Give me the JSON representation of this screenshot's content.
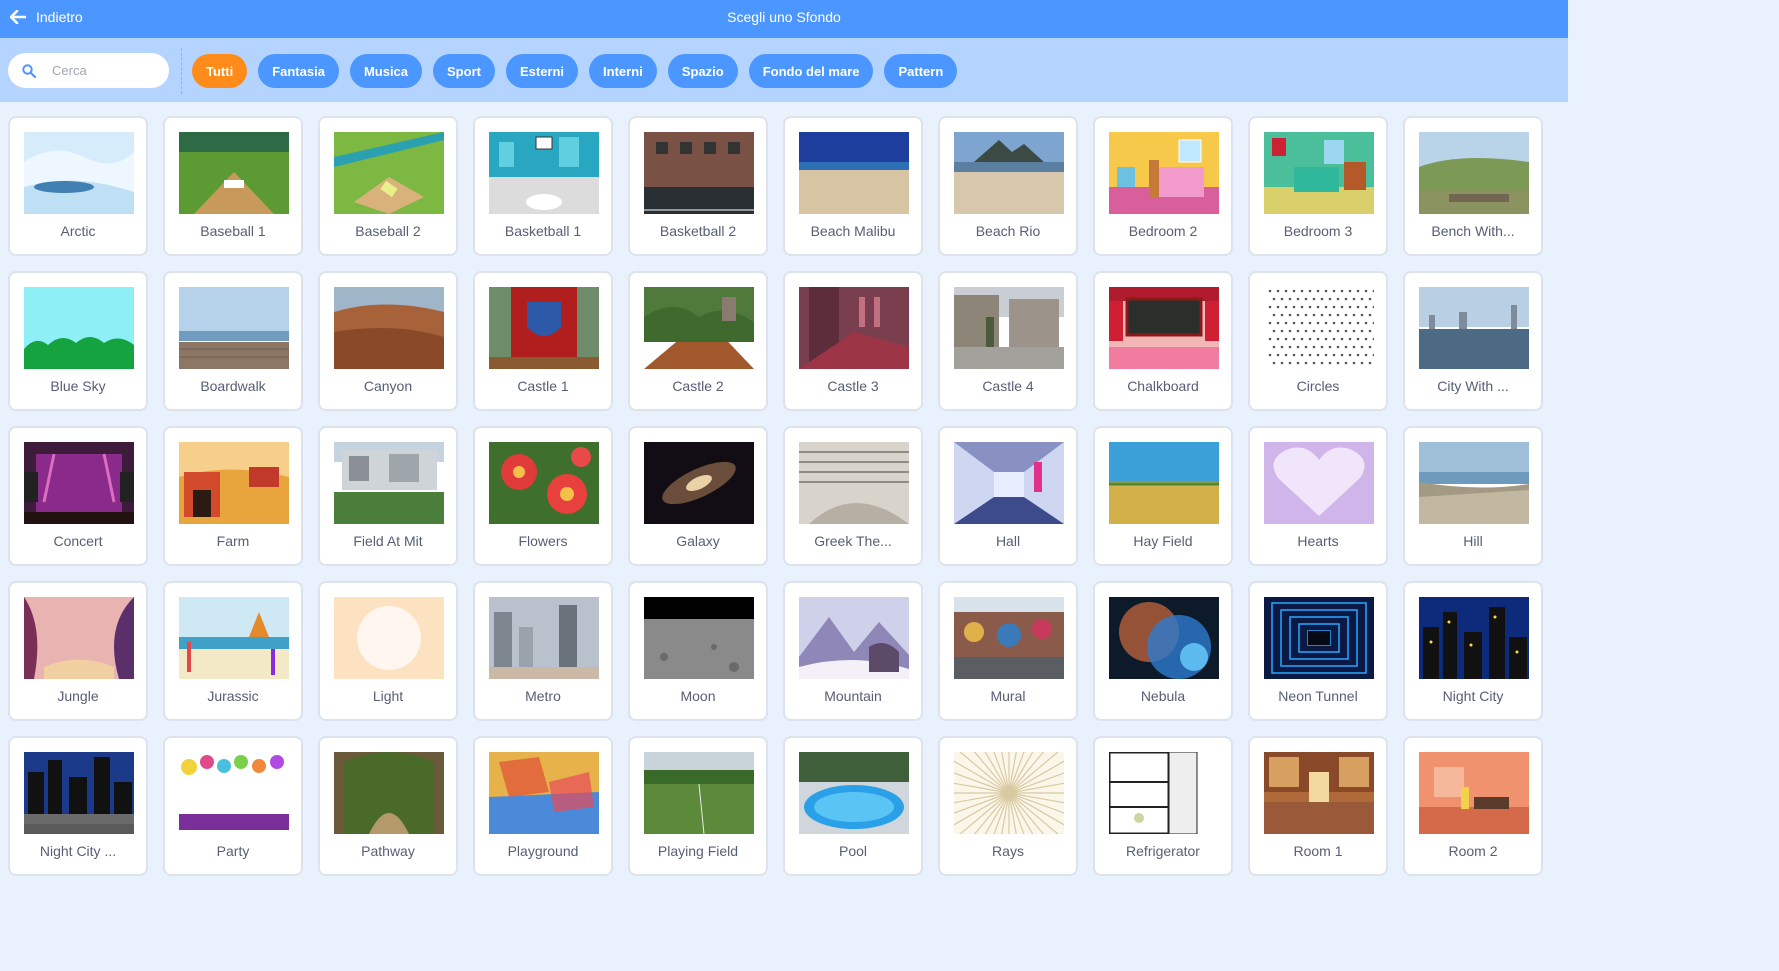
{
  "header": {
    "back_label": "Indietro",
    "title": "Scegli uno Sfondo"
  },
  "search": {
    "placeholder": "Cerca"
  },
  "categories": [
    "Tutti",
    "Fantasia",
    "Musica",
    "Sport",
    "Esterni",
    "Interni",
    "Spazio",
    "Fondo del mare",
    "Pattern"
  ],
  "active_category": "Tutti",
  "colors": {
    "header": "#4c97ff",
    "filterbar": "#b4d4ff",
    "chip": "#4c97ff",
    "chip_active": "#ff8c1a",
    "label": "#575e75"
  },
  "backdrops": [
    {
      "name": "Arctic",
      "thumb": "arctic"
    },
    {
      "name": "Baseball 1",
      "thumb": "baseball1"
    },
    {
      "name": "Baseball 2",
      "thumb": "baseball2"
    },
    {
      "name": "Basketball 1",
      "thumb": "basketball1"
    },
    {
      "name": "Basketball 2",
      "thumb": "basketball2"
    },
    {
      "name": "Beach Malibu",
      "thumb": "beach-malibu"
    },
    {
      "name": "Beach Rio",
      "thumb": "beach-rio"
    },
    {
      "name": "Bedroom 2",
      "thumb": "bedroom2"
    },
    {
      "name": "Bedroom 3",
      "thumb": "bedroom3"
    },
    {
      "name": "Bench With...",
      "thumb": "bench"
    },
    {
      "name": "Blue Sky",
      "thumb": "blue-sky"
    },
    {
      "name": "Boardwalk",
      "thumb": "boardwalk"
    },
    {
      "name": "Canyon",
      "thumb": "canyon"
    },
    {
      "name": "Castle 1",
      "thumb": "castle1"
    },
    {
      "name": "Castle 2",
      "thumb": "castle2"
    },
    {
      "name": "Castle 3",
      "thumb": "castle3"
    },
    {
      "name": "Castle 4",
      "thumb": "castle4"
    },
    {
      "name": "Chalkboard",
      "thumb": "chalkboard"
    },
    {
      "name": "Circles",
      "thumb": "circles"
    },
    {
      "name": "City With ...",
      "thumb": "city-water"
    },
    {
      "name": "Concert",
      "thumb": "concert"
    },
    {
      "name": "Farm",
      "thumb": "farm"
    },
    {
      "name": "Field At Mit",
      "thumb": "field-mit"
    },
    {
      "name": "Flowers",
      "thumb": "flowers"
    },
    {
      "name": "Galaxy",
      "thumb": "galaxy"
    },
    {
      "name": "Greek The...",
      "thumb": "greek-theater"
    },
    {
      "name": "Hall",
      "thumb": "hall"
    },
    {
      "name": "Hay Field",
      "thumb": "hay-field"
    },
    {
      "name": "Hearts",
      "thumb": "hearts"
    },
    {
      "name": "Hill",
      "thumb": "hill"
    },
    {
      "name": "Jungle",
      "thumb": "jungle"
    },
    {
      "name": "Jurassic",
      "thumb": "jurassic"
    },
    {
      "name": "Light",
      "thumb": "light"
    },
    {
      "name": "Metro",
      "thumb": "metro"
    },
    {
      "name": "Moon",
      "thumb": "moon"
    },
    {
      "name": "Mountain",
      "thumb": "mountain"
    },
    {
      "name": "Mural",
      "thumb": "mural"
    },
    {
      "name": "Nebula",
      "thumb": "nebula"
    },
    {
      "name": "Neon Tunnel",
      "thumb": "neon-tunnel"
    },
    {
      "name": "Night City",
      "thumb": "night-city"
    },
    {
      "name": "Night City ...",
      "thumb": "night-city-street"
    },
    {
      "name": "Party",
      "thumb": "party"
    },
    {
      "name": "Pathway",
      "thumb": "pathway"
    },
    {
      "name": "Playground",
      "thumb": "playground"
    },
    {
      "name": "Playing Field",
      "thumb": "playing-field"
    },
    {
      "name": "Pool",
      "thumb": "pool"
    },
    {
      "name": "Rays",
      "thumb": "rays"
    },
    {
      "name": "Refrigerator",
      "thumb": "refrigerator"
    },
    {
      "name": "Room 1",
      "thumb": "room1"
    },
    {
      "name": "Room 2",
      "thumb": "room2"
    }
  ]
}
